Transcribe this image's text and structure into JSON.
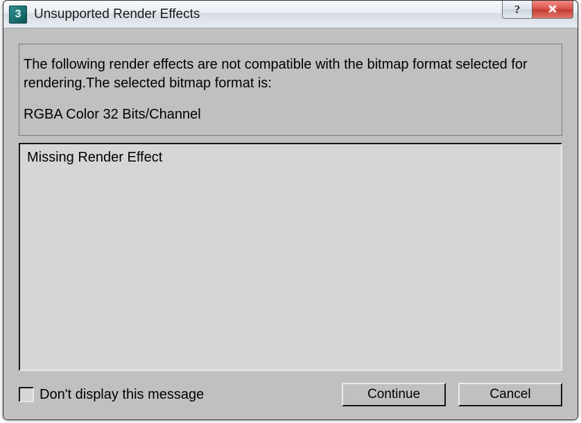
{
  "window": {
    "title": "Unsupported Render Effects",
    "app_icon_glyph": "3"
  },
  "message": {
    "line1": "The following render effects are not compatible with the bitmap format selected for rendering.The selected bitmap format is:",
    "format": "RGBA Color 32 Bits/Channel"
  },
  "list": {
    "items": [
      "Missing Render Effect"
    ]
  },
  "footer": {
    "checkbox_label": "Don't display this message",
    "continue_label": "Continue",
    "cancel_label": "Cancel"
  }
}
